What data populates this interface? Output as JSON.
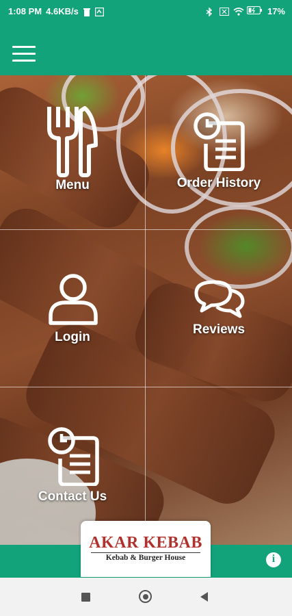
{
  "status_bar": {
    "time": "1:08 PM",
    "speed": "4.6KB/s",
    "battery": "17%",
    "icons": [
      "trash-icon",
      "sync-icon",
      "bluetooth-icon",
      "signal-icon",
      "wifi-icon",
      "battery-icon"
    ]
  },
  "app_bar": {
    "menu_icon": "hamburger-icon"
  },
  "tiles": {
    "menu": {
      "label": "Menu",
      "icon": "fork-knife-icon"
    },
    "order_history": {
      "label": "Order History",
      "icon": "clock-document-icon"
    },
    "login": {
      "label": "Login",
      "icon": "user-icon"
    },
    "reviews": {
      "label": "Reviews",
      "icon": "chat-bubbles-icon"
    },
    "contact_us": {
      "label": "Contact Us",
      "icon": "clock-document-icon"
    }
  },
  "logo": {
    "name": "AKAR KEBAB",
    "tagline": "Kebab & Burger House"
  },
  "footer": {
    "info_icon": "info-icon",
    "info_glyph": "i"
  },
  "colors": {
    "brand_green": "#12a37a",
    "logo_red": "#b0322f"
  }
}
